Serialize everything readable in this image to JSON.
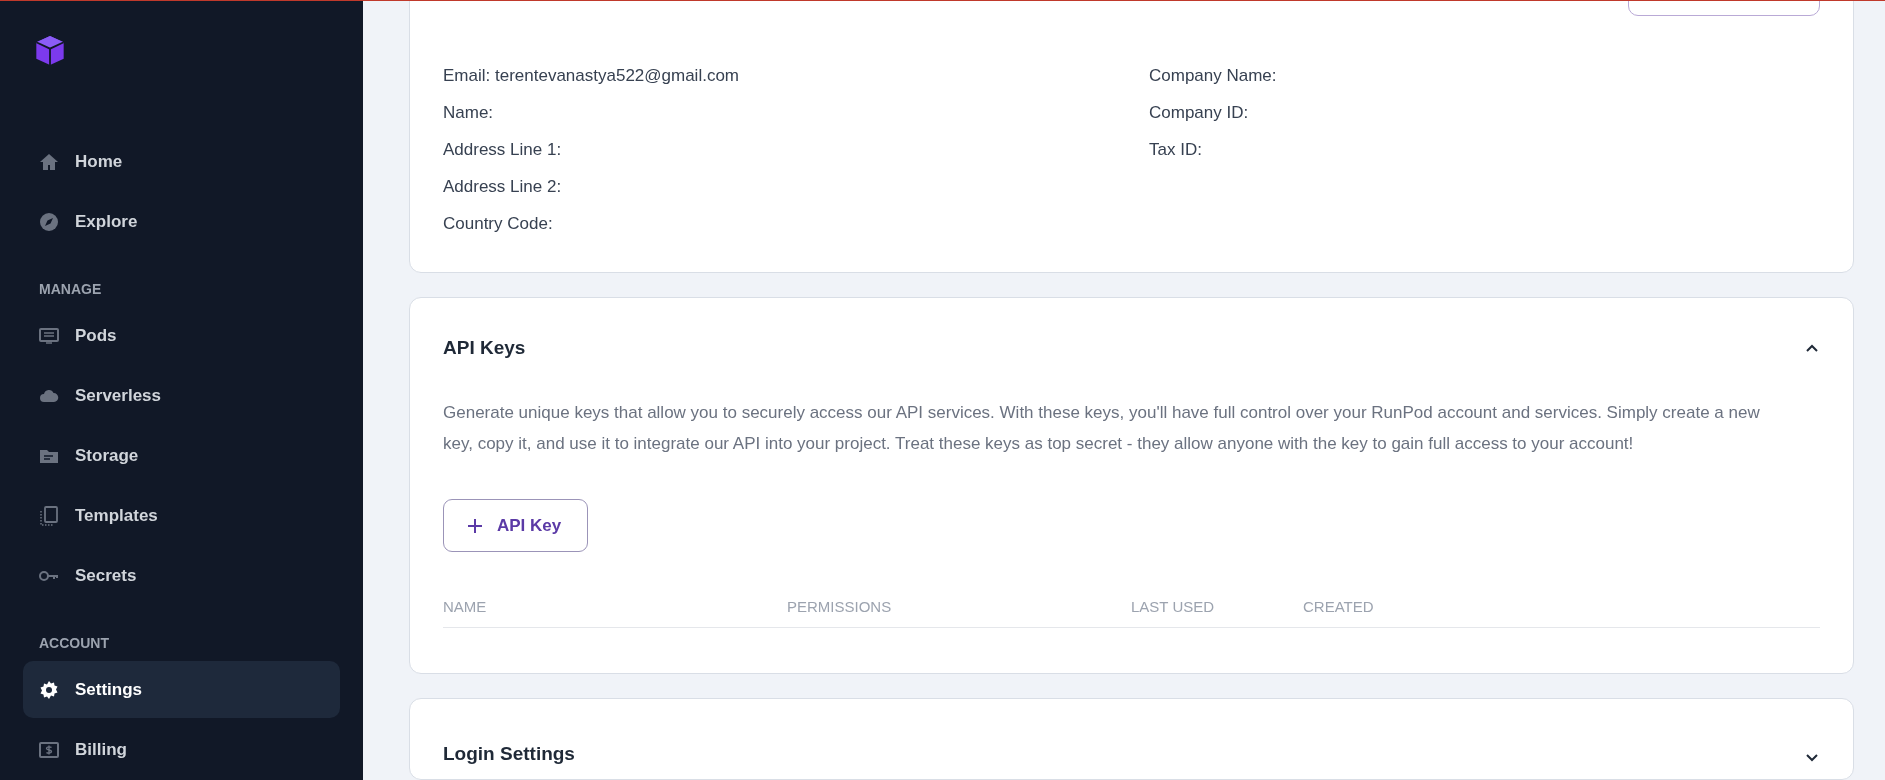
{
  "sidebar": {
    "items": [
      {
        "kind": "link",
        "label": "Home",
        "selected": false
      },
      {
        "kind": "link",
        "label": "Explore",
        "selected": false
      },
      {
        "kind": "heading",
        "label": "MANAGE"
      },
      {
        "kind": "link",
        "label": "Pods",
        "selected": false
      },
      {
        "kind": "link",
        "label": "Serverless",
        "selected": false
      },
      {
        "kind": "link",
        "label": "Storage",
        "selected": false
      },
      {
        "kind": "link",
        "label": "Templates",
        "selected": false
      },
      {
        "kind": "link",
        "label": "Secrets",
        "selected": false
      },
      {
        "kind": "heading",
        "label": "ACCOUNT"
      },
      {
        "kind": "link",
        "label": "Settings",
        "selected": true
      },
      {
        "kind": "link",
        "label": "Billing",
        "selected": false
      }
    ]
  },
  "account_details": {
    "left_fields": [
      "Email: terentevanastya522@gmail.com",
      "Name:",
      "Address Line 1:",
      "Address Line 2:",
      "Country Code:"
    ],
    "right_fields": [
      "Company Name:",
      "Company ID:",
      "Tax ID:"
    ]
  },
  "api_keys": {
    "title": "API Keys",
    "expanded": true,
    "description": "Generate unique keys that allow you to securely access our API services. With these keys, you'll have full control over your RunPod account and services. Simply create a new key, copy it, and use it to integrate our API into your project. Treat these keys as top secret - they allow anyone with the key to gain full access to your account!",
    "add_button": "API Key",
    "table": {
      "columns": [
        "NAME",
        "PERMISSIONS",
        "LAST USED",
        "CREATED"
      ]
    }
  },
  "login_settings": {
    "title": "Login Settings"
  }
}
